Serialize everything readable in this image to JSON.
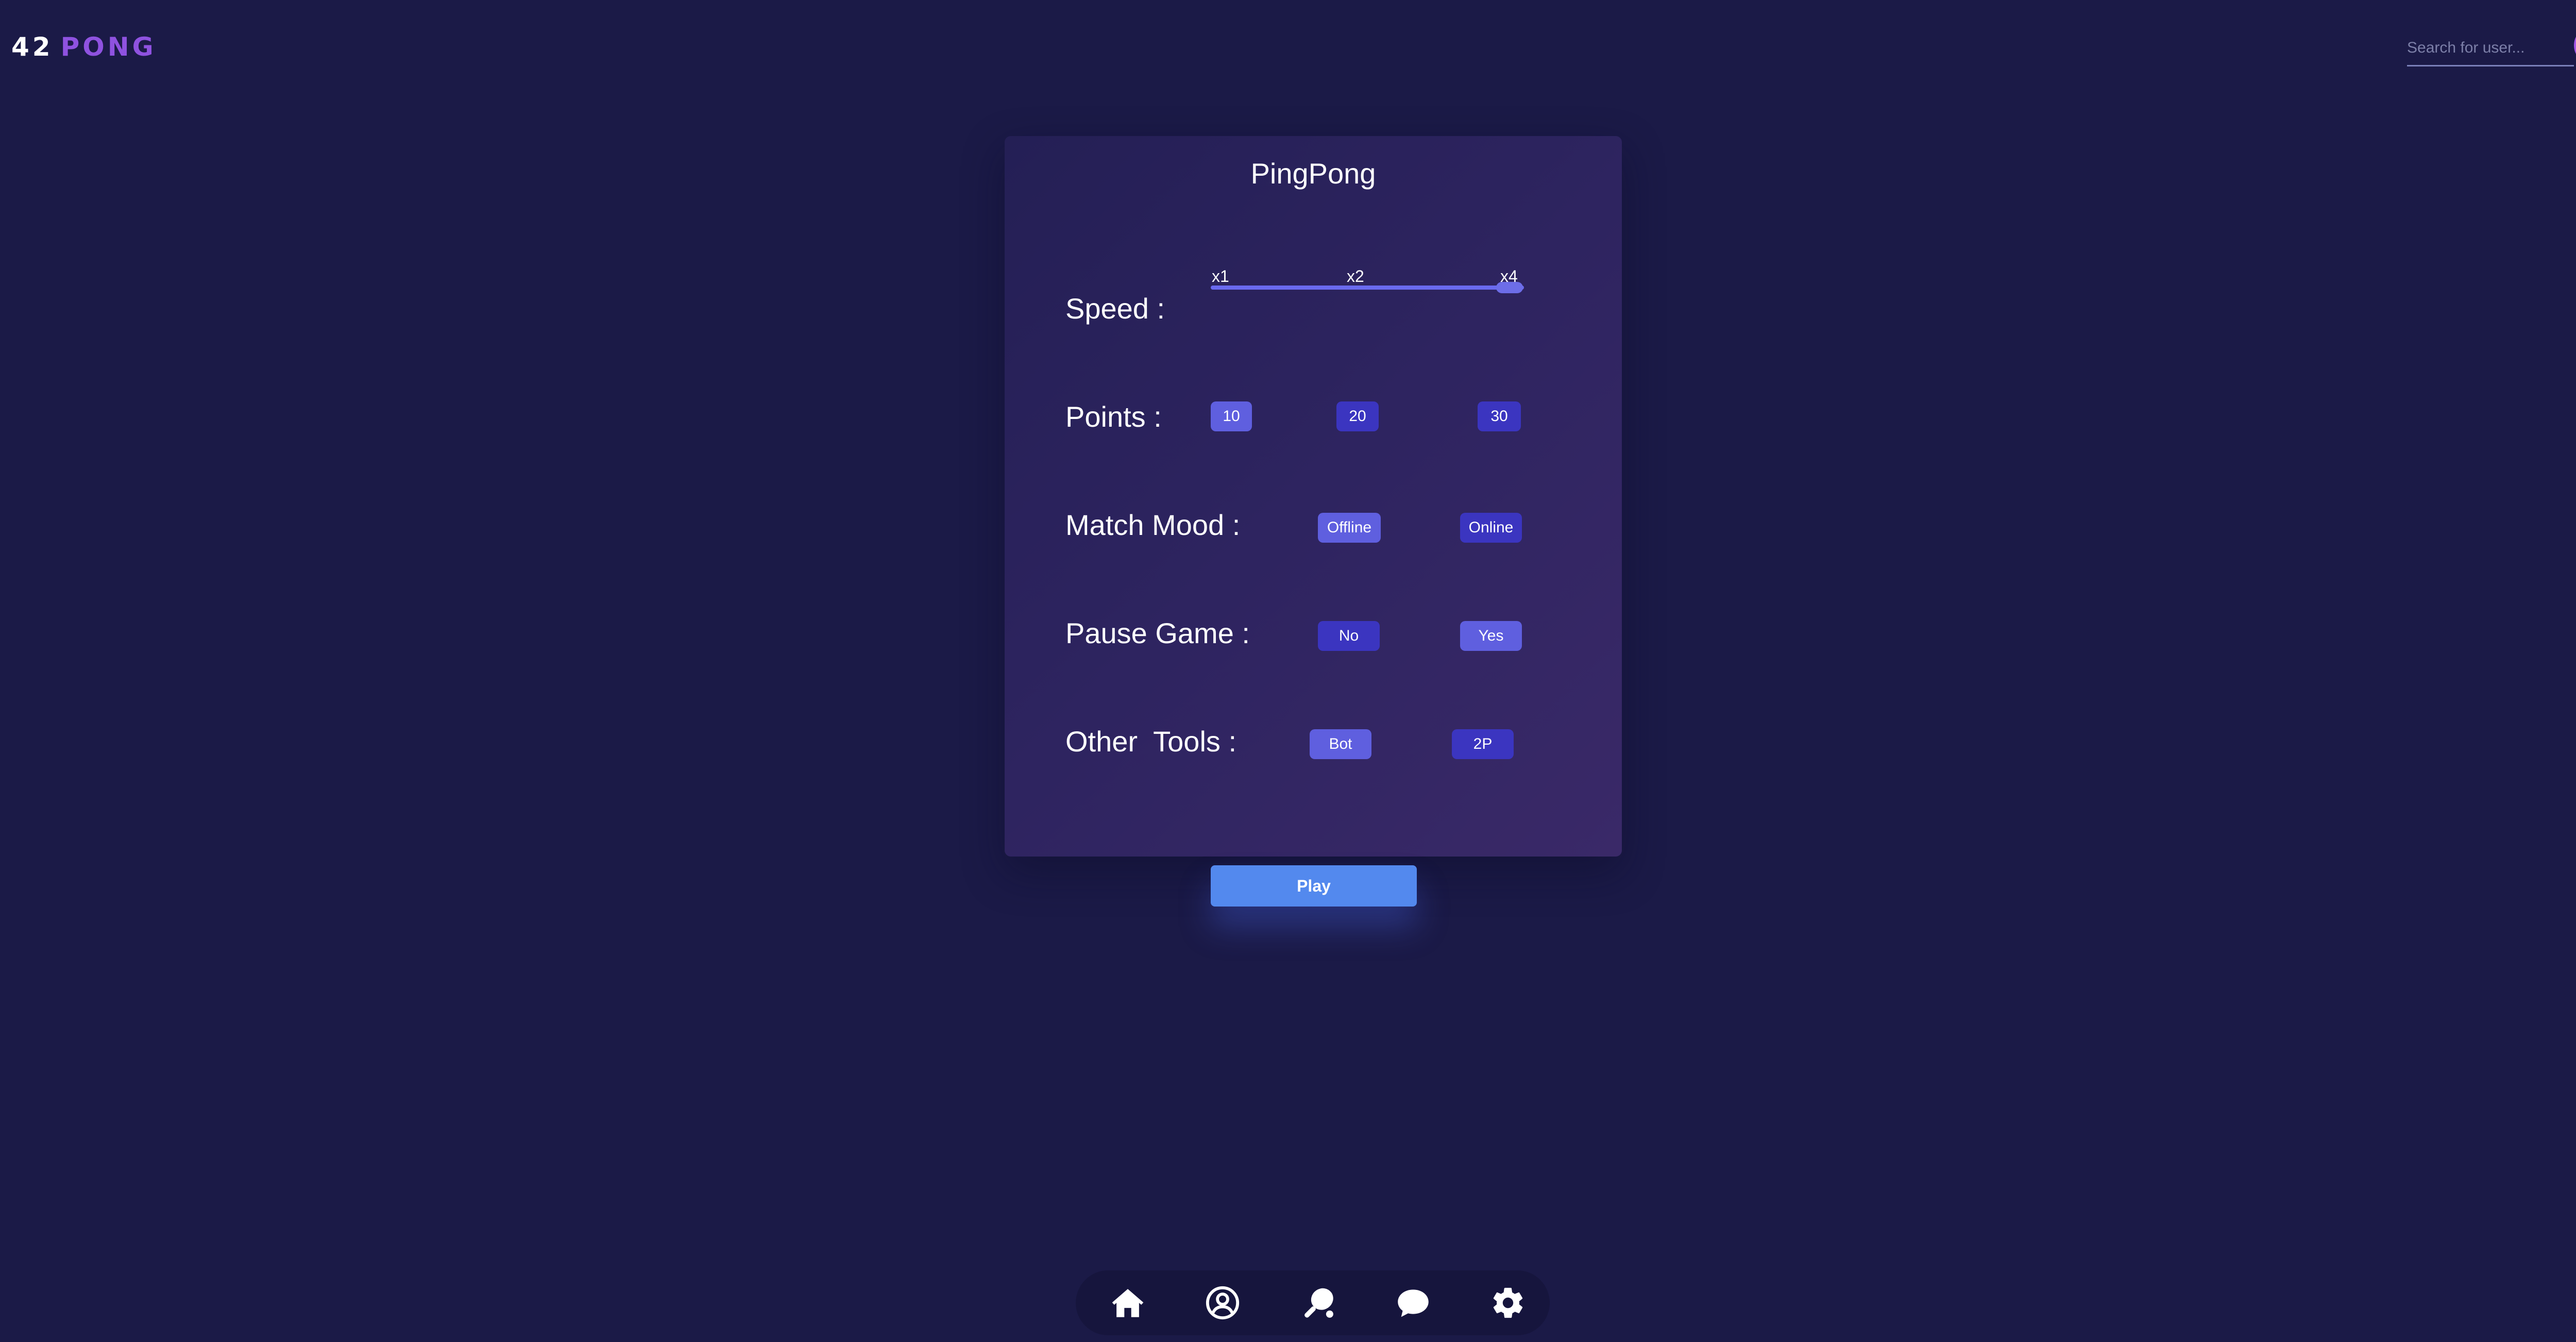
{
  "header": {
    "logo_number": "42",
    "logo_word": "PONG",
    "search_placeholder": "Search for user..."
  },
  "card": {
    "title": "PingPong",
    "speed": {
      "label": "Speed :",
      "ticks": [
        "x1",
        "x2",
        "x4"
      ],
      "selected": "x4"
    },
    "points": {
      "label": "Points :",
      "options": [
        "10",
        "20",
        "30"
      ],
      "selected": "10"
    },
    "match_mood": {
      "label": "Match Mood :",
      "options": [
        "Offline",
        "Online"
      ],
      "selected": "Offline"
    },
    "pause_game": {
      "label": "Pause Game :",
      "options": [
        "No",
        "Yes"
      ],
      "selected": "Yes"
    },
    "other_tools": {
      "label": "Other  Tools :",
      "options": [
        "Bot",
        "2P"
      ],
      "selected": "Bot"
    }
  },
  "play_button": "Play",
  "bottom_nav": {
    "items": [
      "home-icon",
      "profile-icon",
      "game-icon",
      "chat-icon",
      "settings-icon"
    ]
  },
  "colors": {
    "background": "#1b1a47",
    "accent_purple": "#8f52e0",
    "option_active": "#5f5fdf",
    "option_inactive": "#3b35c0",
    "play_button": "#5389ee"
  }
}
